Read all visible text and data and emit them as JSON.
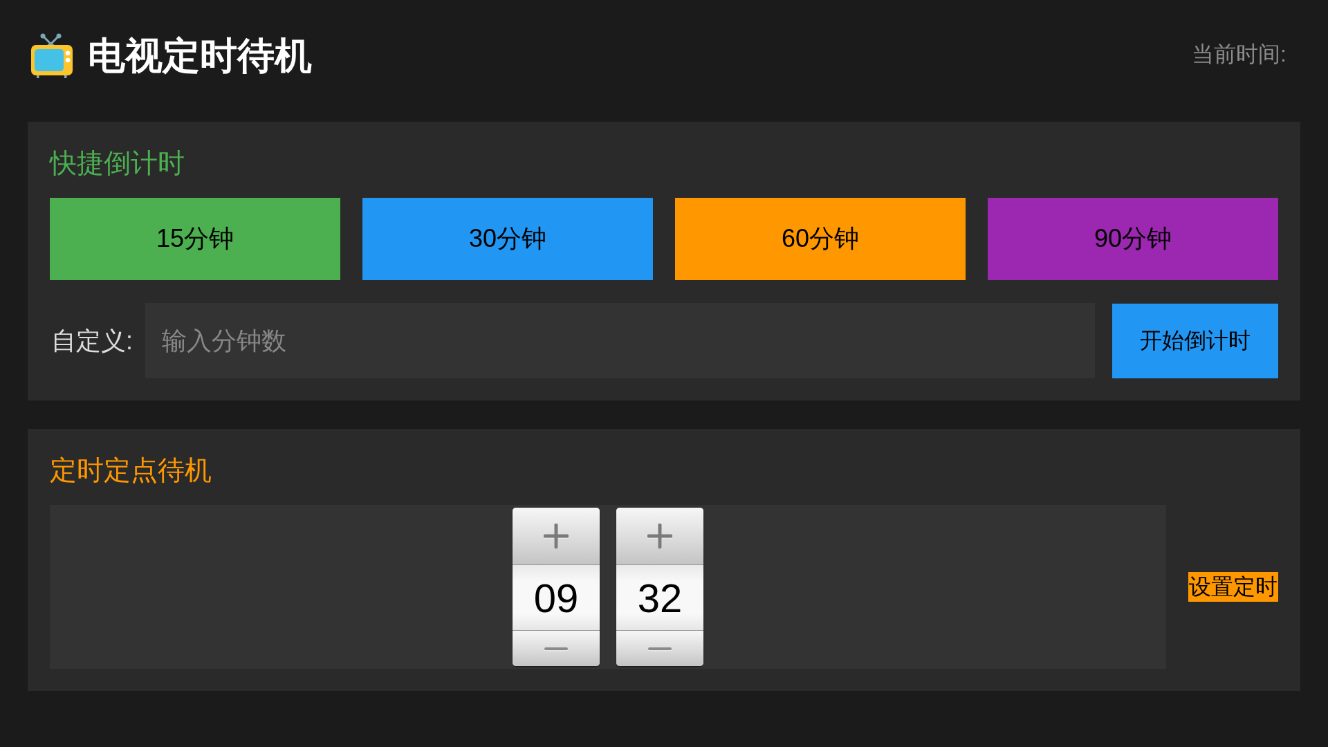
{
  "header": {
    "title": "电视定时待机",
    "clock_label": "当前时间:"
  },
  "quick_countdown": {
    "title": "快捷倒计时",
    "presets": [
      {
        "label": "15分钟",
        "color": "#4caf50"
      },
      {
        "label": "30分钟",
        "color": "#2196f3"
      },
      {
        "label": "60分钟",
        "color": "#ff9800"
      },
      {
        "label": "90分钟",
        "color": "#9c27b0"
      }
    ],
    "custom": {
      "label": "自定义:",
      "placeholder": "输入分钟数",
      "button": "开始倒计时"
    }
  },
  "scheduled_standby": {
    "title": "定时定点待机",
    "spinners": [
      {
        "value": "09"
      },
      {
        "value": "32"
      }
    ],
    "button": "设置定时"
  }
}
